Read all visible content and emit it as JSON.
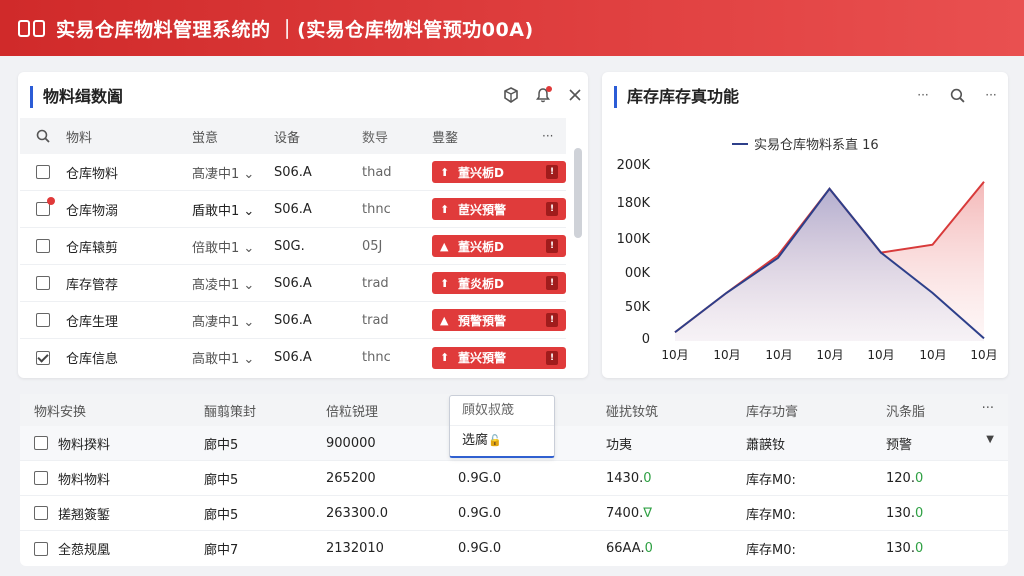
{
  "app": {
    "title": "实易仓库物料管理系统的 ｜(实易仓库物料管预功00A)"
  },
  "left_panel": {
    "title": "物料缉数阖",
    "columns": [
      "物料",
      "蛍意",
      "设备",
      "数导",
      "豊鍪",
      "···"
    ],
    "rows": [
      {
        "name": "仓库物料",
        "status": "髙凄中1 ⌄",
        "device": "S06.A",
        "num": "thad",
        "action": "董兴栃D",
        "checked": false,
        "dot": false,
        "icon": "▲"
      },
      {
        "name": "仓库物溺",
        "status": "盾敢中1 ⌄",
        "device": "S06.A",
        "num": "thnc",
        "action": "茞兴預警",
        "checked": false,
        "dot": true,
        "icon": "▲"
      },
      {
        "name": "仓库辕剪",
        "status": "倍敢中1 ⌄",
        "device": "S0G.",
        "num": "05J",
        "action": "董兴栃D",
        "checked": false,
        "dot": false,
        "icon": "▲"
      },
      {
        "name": "库存管荐",
        "status": "髙凌中1 ⌄",
        "device": "S06.A",
        "num": "trad",
        "action": "董炎栃D",
        "checked": false,
        "dot": false,
        "icon": "▲"
      },
      {
        "name": "仓库生理",
        "status": "髙凄中1 ⌄",
        "device": "S06.A",
        "num": "trad",
        "action": "預警預警",
        "checked": false,
        "dot": false,
        "icon": "▲"
      },
      {
        "name": "仓库信息",
        "status": "高敢中1 ⌄",
        "device": "S06.A",
        "num": "thnc",
        "action": "董兴預警",
        "checked": true,
        "dot": false,
        "icon": "▲"
      }
    ]
  },
  "right_panel": {
    "title": "库存库存真功能",
    "legend": "实易仓库物料系直 16"
  },
  "chart_data": {
    "type": "line",
    "title": "",
    "legend": "实易仓库物料系直 16",
    "x": [
      "10月",
      "10月",
      "10月",
      "10月",
      "10月",
      "10月",
      "10月"
    ],
    "yticks": [
      "200K",
      "180K",
      "100K",
      "00K",
      "50K",
      "0"
    ],
    "ylim": [
      0,
      200
    ],
    "series": [
      {
        "name": "实易仓库物料系直 16",
        "color": "#2d3f8a",
        "values": [
          10,
          55,
          95,
          174,
          101,
          55,
          3
        ]
      },
      {
        "color": "#d83a3a",
        "values": [
          10,
          55,
          98,
          174,
          101,
          110,
          182
        ]
      }
    ],
    "grid": false
  },
  "bottom_table": {
    "columns": [
      "物料安换",
      "酾翦策封",
      "倍粒锐理",
      "頋奴叔筬",
      "碰扰钕筑",
      "库存功膏",
      "汎条脂",
      "···"
    ],
    "dropdown_value": "选腐",
    "rows": [
      {
        "c1": "物料揆料",
        "c2": "廊中5",
        "c3": "900000",
        "c4": "",
        "c5": "功夷",
        "c6": "蕭韺钕",
        "c7": "预警"
      },
      {
        "c1": "物料物料",
        "c2": "廊中5",
        "c3": "265200",
        "c4": "0.9G.0",
        "c5": "1430.",
        "c5b": "0",
        "c6": "库存M0:",
        "c7": "120.",
        "c7b": "0"
      },
      {
        "c1": "搓翘簽錾",
        "c2": "廊中5",
        "c3": "263300.0",
        "c4": "0.9G.0",
        "c5": "7400.",
        "c5b": "∇",
        "c6": "库存M0:",
        "c7": "130.",
        "c7b": "0"
      },
      {
        "c1": "全葾规凰",
        "c2": "廊中7",
        "c3": "2132010",
        "c4": "0.9G.0",
        "c5": "66AA.",
        "c5b": "0",
        "c6": "库存M0:",
        "c7": "130.",
        "c7b": "0"
      }
    ]
  },
  "colors": {
    "brand_red": "#d83232",
    "accent_blue": "#2b5cd6",
    "series_navy": "#2d3f8a",
    "series_red": "#d83a3a"
  }
}
